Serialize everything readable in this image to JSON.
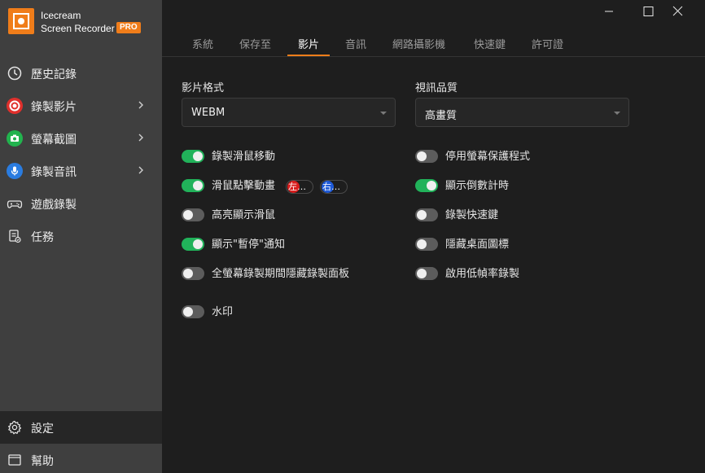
{
  "app": {
    "brand_line1": "Icecream",
    "brand_line2": "Screen Recorder",
    "badge": "PRO",
    "accent": "#f07d1a"
  },
  "sidebar": {
    "items": [
      {
        "label": "歷史記錄",
        "icon": "clock-icon"
      },
      {
        "label": "錄製影片",
        "icon": "record-icon"
      },
      {
        "label": "螢幕截圖",
        "icon": "camera-icon"
      },
      {
        "label": "錄製音訊",
        "icon": "microphone-icon"
      },
      {
        "label": "遊戲錄製",
        "icon": "gamepad-icon"
      },
      {
        "label": "任務",
        "icon": "task-icon"
      }
    ],
    "bottom": [
      {
        "label": "設定",
        "icon": "gear-icon"
      },
      {
        "label": "幫助",
        "icon": "help-icon"
      }
    ]
  },
  "tabs": [
    "系統",
    "保存至",
    "影片",
    "音訊",
    "網路攝影機",
    "快速鍵",
    "許可證"
  ],
  "active_tab": "影片",
  "video_format": {
    "label": "影片格式",
    "value": "WEBM"
  },
  "video_quality": {
    "label": "視訊品質",
    "value": "高畫質"
  },
  "left_options": [
    {
      "label": "錄製滑鼠移動",
      "on": true
    },
    {
      "label": "滑鼠點擊動畫",
      "on": true,
      "left_click": "左…",
      "right_click": "右…"
    },
    {
      "label": "高亮顯示滑鼠",
      "on": false
    },
    {
      "label": "顯示\"暫停\"通知",
      "on": true
    },
    {
      "label": "全螢幕錄製期間隱藏錄製面板",
      "on": false
    }
  ],
  "right_options": [
    {
      "label": "停用螢幕保護程式",
      "on": false
    },
    {
      "label": "顯示倒數計時",
      "on": true
    },
    {
      "label": "錄製快速鍵",
      "on": false
    },
    {
      "label": "隱藏桌面圖標",
      "on": false
    },
    {
      "label": "啟用低幀率錄製",
      "on": false
    }
  ],
  "watermark": {
    "label": "水印",
    "on": false
  },
  "colors": {
    "toggle_on": "#21b25a",
    "toggle_off": "#5c5c5c",
    "left_click": "#d81e1e",
    "right_click": "#1e5ad8"
  }
}
